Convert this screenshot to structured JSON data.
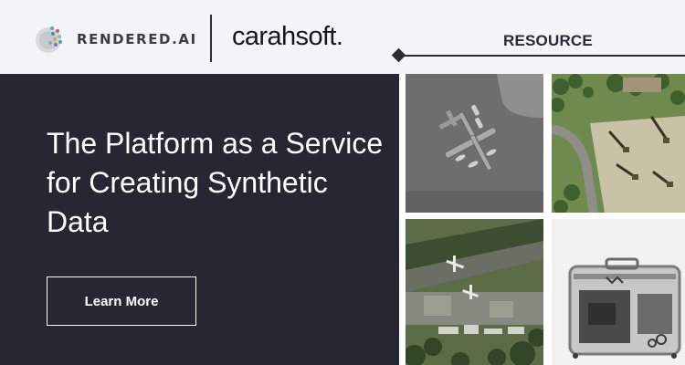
{
  "header": {
    "brand_name": "RENDERED.AI",
    "partner_name": "carahsoft.",
    "resource_label": "RESOURCE"
  },
  "hero": {
    "headline": "The Platform as a Service for Creating Synthetic Data",
    "cta_label": "Learn More"
  },
  "images": [
    {
      "name": "synthetic-aircraft-render-image"
    },
    {
      "name": "aerial-construction-site-image"
    },
    {
      "name": "aerial-airfield-image"
    },
    {
      "name": "xray-luggage-scan-image"
    }
  ],
  "colors": {
    "hero_background": "#272733",
    "header_background": "#f3f4f6",
    "text_light": "#ffffff",
    "text_dark": "#2a2a33"
  }
}
